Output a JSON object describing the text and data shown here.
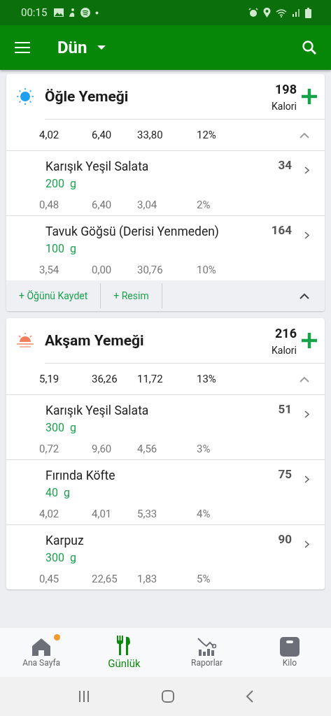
{
  "status_bar": {
    "time": "00:15"
  },
  "app_bar": {
    "title": "Dün"
  },
  "meals": [
    {
      "kind": "lunch",
      "title": "Öğle Yemeği",
      "calories": "198",
      "calories_label": "Kalori",
      "totals": [
        "4,02",
        "6,40",
        "33,80",
        "12%"
      ],
      "expanded": true,
      "items": [
        {
          "name": "Karışık Yeşil Salata",
          "calories": "34",
          "amount": "200",
          "unit": "g",
          "macros": [
            "0,48",
            "6,40",
            "3,04",
            "2%"
          ]
        },
        {
          "name": "Tavuk Göğsü (Derisi Yenmeden)",
          "calories": "164",
          "amount": "100",
          "unit": "g",
          "macros": [
            "3,54",
            "0,00",
            "30,76",
            "10%"
          ]
        }
      ],
      "actions": [
        "+ Öğünü Kaydet",
        "+ Resim"
      ]
    },
    {
      "kind": "dinner",
      "title": "Akşam Yemeği",
      "calories": "216",
      "calories_label": "Kalori",
      "totals": [
        "5,19",
        "36,26",
        "11,72",
        "13%"
      ],
      "expanded": true,
      "items": [
        {
          "name": "Karışık Yeşil Salata",
          "calories": "51",
          "amount": "300",
          "unit": "g",
          "macros": [
            "0,72",
            "9,60",
            "4,56",
            "3%"
          ]
        },
        {
          "name": "Fırında Köfte",
          "calories": "75",
          "amount": "40",
          "unit": "g",
          "macros": [
            "4,02",
            "4,01",
            "5,33",
            "4%"
          ]
        },
        {
          "name": "Karpuz",
          "calories": "90",
          "amount": "300",
          "unit": "g",
          "macros": [
            "0,45",
            "22,65",
            "1,83",
            "5%"
          ]
        }
      ]
    }
  ],
  "bottom_nav": [
    {
      "kind": "home",
      "label": "Ana Sayfa",
      "selected": false,
      "notification": true
    },
    {
      "kind": "diary",
      "label": "Günlük",
      "selected": true,
      "notification": false
    },
    {
      "kind": "reports",
      "label": "Raporlar",
      "selected": false,
      "notification": false
    },
    {
      "kind": "weight",
      "label": "Kilo",
      "selected": false,
      "notification": false
    }
  ]
}
